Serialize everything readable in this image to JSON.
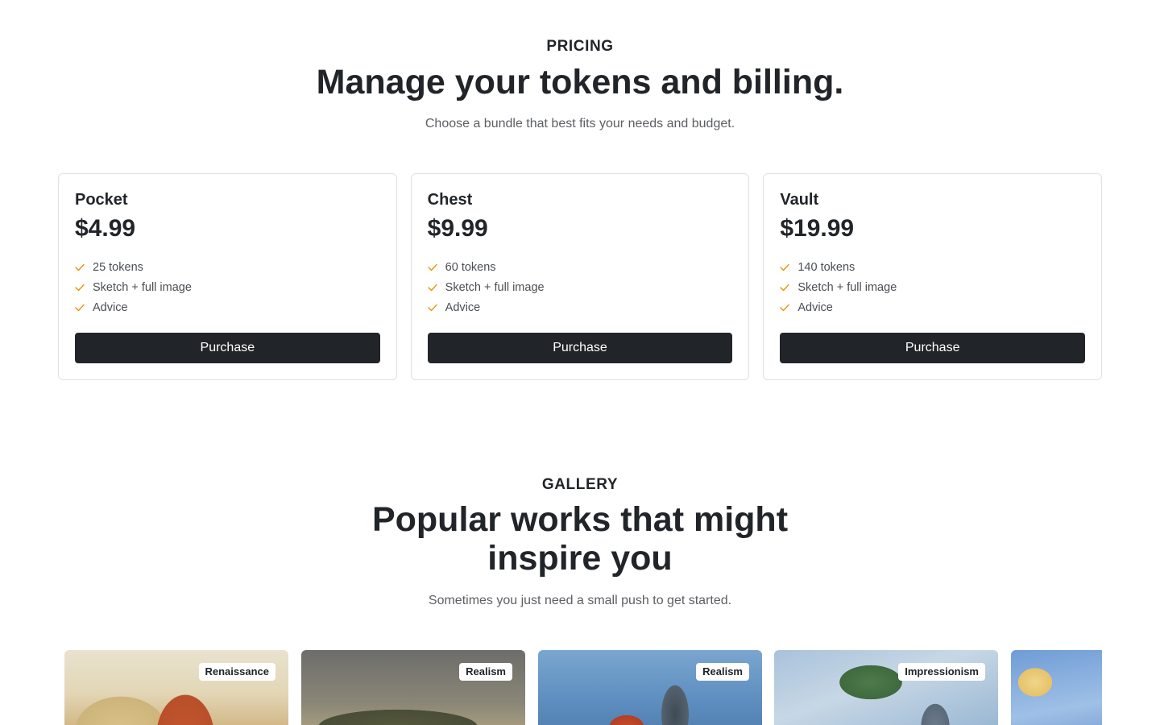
{
  "pricing": {
    "eyebrow": "PRICING",
    "title": "Manage your tokens and billing.",
    "subtitle": "Choose a bundle that best fits your needs and budget.",
    "plans": [
      {
        "name": "Pocket",
        "price": "$4.99",
        "features": [
          "25 tokens",
          "Sketch + full image",
          "Advice"
        ],
        "button": "Purchase"
      },
      {
        "name": "Chest",
        "price": "$9.99",
        "features": [
          "60 tokens",
          "Sketch + full image",
          "Advice"
        ],
        "button": "Purchase"
      },
      {
        "name": "Vault",
        "price": "$19.99",
        "features": [
          "140 tokens",
          "Sketch + full image",
          "Advice"
        ],
        "button": "Purchase"
      }
    ],
    "check_icon": "check-icon",
    "check_color": "#f08c00"
  },
  "gallery": {
    "eyebrow": "GALLERY",
    "title_line1": "Popular works that might",
    "title_line2": "inspire you",
    "subtitle": "Sometimes you just need a small push to get started.",
    "items": [
      {
        "style": "Renaissance"
      },
      {
        "style": "Realism"
      },
      {
        "style": "Realism"
      },
      {
        "style": "Impressionism"
      },
      {
        "style": ""
      }
    ]
  },
  "colors": {
    "button_bg": "#212529",
    "border": "#dee2e6",
    "text": "#212529",
    "muted": "#5c5f63"
  }
}
